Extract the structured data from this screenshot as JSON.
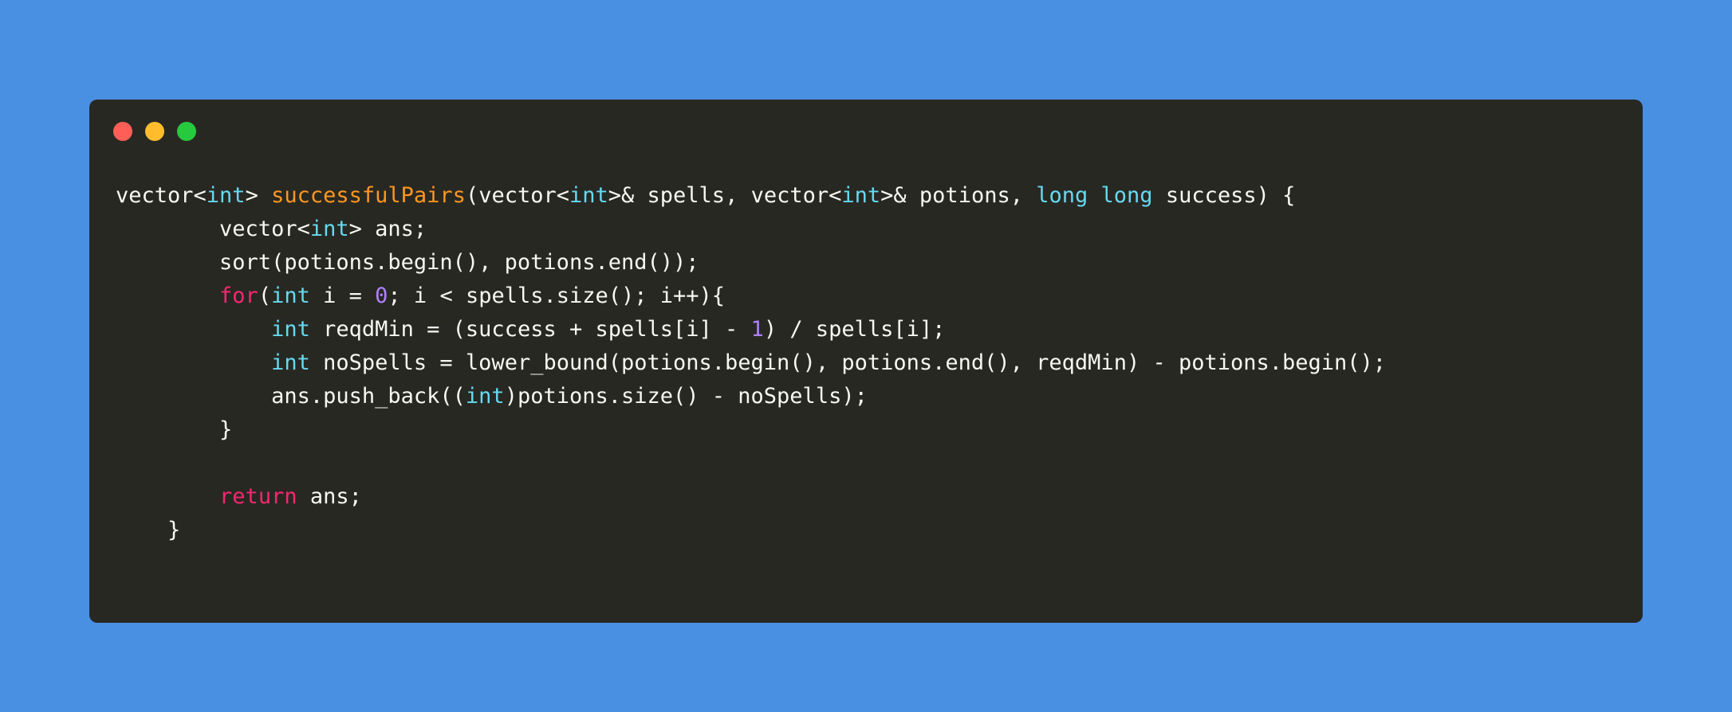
{
  "window": {
    "controls": [
      "close",
      "minimize",
      "maximize"
    ]
  },
  "colors": {
    "background": "#4a90e2",
    "window": "#282823",
    "text": "#f8f8f2",
    "type": "#66d9ef",
    "function": "#fd971f",
    "keyword": "#f92672",
    "number": "#ae81ff"
  },
  "code": {
    "lines": [
      [
        {
          "t": "vector<",
          "k": "plain"
        },
        {
          "t": "int",
          "k": "type"
        },
        {
          "t": "> ",
          "k": "plain"
        },
        {
          "t": "successfulPairs",
          "k": "fn"
        },
        {
          "t": "(vector<",
          "k": "plain"
        },
        {
          "t": "int",
          "k": "type"
        },
        {
          "t": ">& spells, vector<",
          "k": "plain"
        },
        {
          "t": "int",
          "k": "type"
        },
        {
          "t": ">& potions, ",
          "k": "plain"
        },
        {
          "t": "long",
          "k": "type"
        },
        {
          "t": " ",
          "k": "plain"
        },
        {
          "t": "long",
          "k": "type"
        },
        {
          "t": " success) {",
          "k": "plain"
        }
      ],
      [
        {
          "t": "        vector<",
          "k": "plain"
        },
        {
          "t": "int",
          "k": "type"
        },
        {
          "t": "> ans;",
          "k": "plain"
        }
      ],
      [
        {
          "t": "        sort(potions.begin(), potions.end());",
          "k": "plain"
        }
      ],
      [
        {
          "t": "        ",
          "k": "plain"
        },
        {
          "t": "for",
          "k": "kw"
        },
        {
          "t": "(",
          "k": "plain"
        },
        {
          "t": "int",
          "k": "type"
        },
        {
          "t": " i = ",
          "k": "plain"
        },
        {
          "t": "0",
          "k": "num"
        },
        {
          "t": "; i < spells.size(); i++){",
          "k": "plain"
        }
      ],
      [
        {
          "t": "            ",
          "k": "plain"
        },
        {
          "t": "int",
          "k": "type"
        },
        {
          "t": " reqdMin = (success + spells[i] - ",
          "k": "plain"
        },
        {
          "t": "1",
          "k": "num"
        },
        {
          "t": ") / spells[i];",
          "k": "plain"
        }
      ],
      [
        {
          "t": "            ",
          "k": "plain"
        },
        {
          "t": "int",
          "k": "type"
        },
        {
          "t": " noSpells = lower_bound(potions.begin(), potions.end(), reqdMin) - potions.begin();",
          "k": "plain"
        }
      ],
      [
        {
          "t": "            ans.push_back((",
          "k": "plain"
        },
        {
          "t": "int",
          "k": "type"
        },
        {
          "t": ")potions.size() - noSpells);",
          "k": "plain"
        }
      ],
      [
        {
          "t": "        }",
          "k": "plain"
        }
      ],
      [
        {
          "t": "",
          "k": "plain"
        }
      ],
      [
        {
          "t": "        ",
          "k": "plain"
        },
        {
          "t": "return",
          "k": "kw"
        },
        {
          "t": " ans;",
          "k": "plain"
        }
      ],
      [
        {
          "t": "    }",
          "k": "plain"
        }
      ]
    ]
  }
}
